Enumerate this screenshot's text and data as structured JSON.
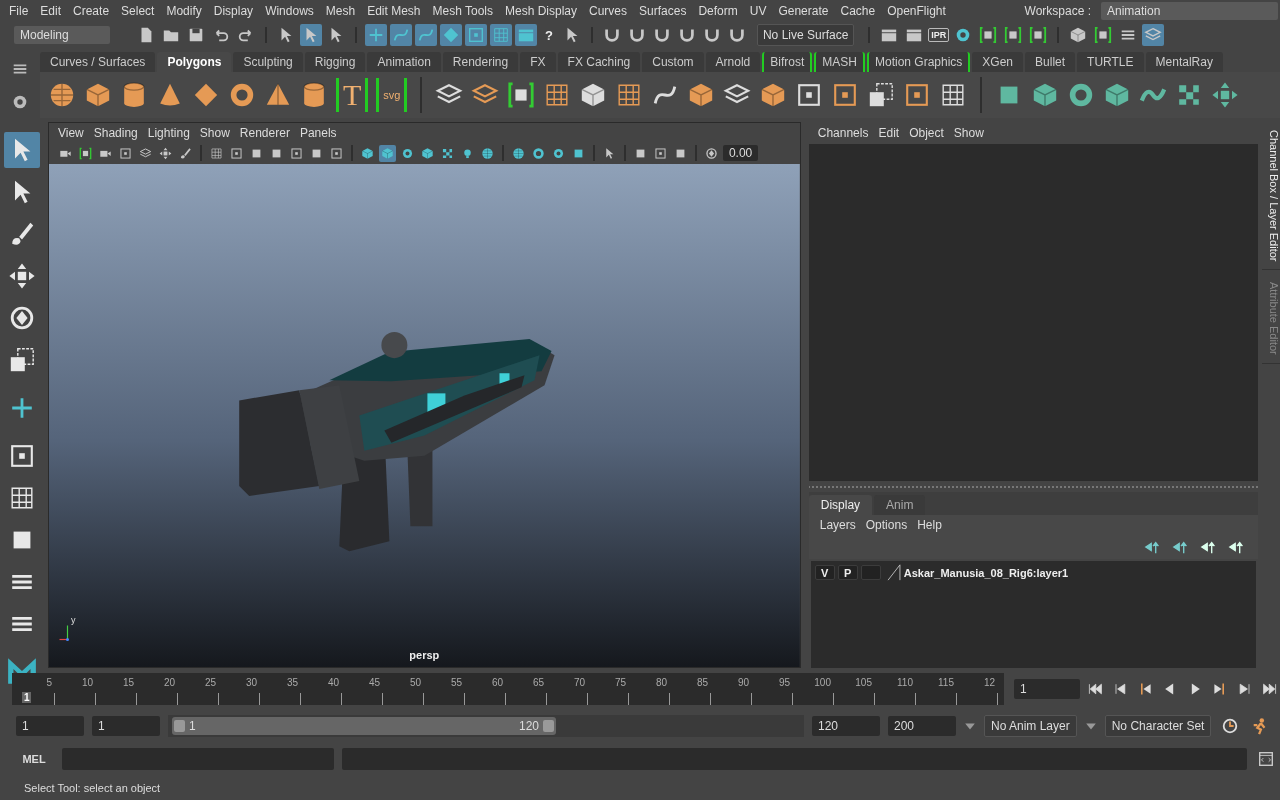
{
  "menu_bar": [
    "File",
    "Edit",
    "Create",
    "Select",
    "Modify",
    "Display",
    "Windows",
    "Mesh",
    "Edit Mesh",
    "Mesh Tools",
    "Mesh Display",
    "Curves",
    "Surfaces",
    "Deform",
    "UV",
    "Generate",
    "Cache",
    "OpenFlight"
  ],
  "status_line": {
    "menu_set": "Modeling",
    "help_glyph": "?",
    "live_surface": "No Live Surface",
    "render_label": "IPR",
    "workspace_label": "Workspace :",
    "workspace": "Animation",
    "tools": [
      {
        "on": false
      },
      {
        "on": false
      },
      {
        "on": false
      },
      {
        "on": false
      },
      {
        "on": false
      },
      {
        "on": false
      },
      {
        "on": true
      },
      {
        "on": false
      },
      {
        "on": true
      },
      {
        "on": true
      },
      {
        "on": true
      },
      {
        "on": true
      },
      {
        "on": true
      },
      {
        "on": true
      },
      {
        "on": true
      },
      {
        "on": false
      },
      {
        "on": false
      },
      {
        "on": false
      },
      {
        "on": false
      },
      {
        "on": false
      },
      {
        "on": false
      },
      {
        "on": false
      },
      {
        "on": false
      },
      {
        "on": false
      },
      {
        "on": false
      },
      {
        "on": false
      },
      {
        "on": false
      },
      {
        "on": false
      },
      {
        "on": false
      },
      {
        "on": false
      },
      {
        "on": false
      },
      {
        "on": false
      },
      {
        "on": false
      },
      {
        "on": true
      }
    ]
  },
  "shelf": {
    "tabs": [
      {
        "label": "Curves / Surfaces",
        "selected": false,
        "bracketed": false
      },
      {
        "label": "Polygons",
        "selected": true,
        "bracketed": false
      },
      {
        "label": "Sculpting",
        "selected": false,
        "bracketed": false
      },
      {
        "label": "Rigging",
        "selected": false,
        "bracketed": false
      },
      {
        "label": "Animation",
        "selected": false,
        "bracketed": false
      },
      {
        "label": "Rendering",
        "selected": false,
        "bracketed": false
      },
      {
        "label": "FX",
        "selected": false,
        "bracketed": false
      },
      {
        "label": "FX Caching",
        "selected": false,
        "bracketed": false
      },
      {
        "label": "Custom",
        "selected": false,
        "bracketed": false
      },
      {
        "label": "Arnold",
        "selected": false,
        "bracketed": false
      },
      {
        "label": "Bifrost",
        "selected": false,
        "bracketed": true
      },
      {
        "label": "MASH",
        "selected": false,
        "bracketed": true
      },
      {
        "label": "Motion Graphics",
        "selected": false,
        "bracketed": true
      },
      {
        "label": "XGen",
        "selected": false,
        "bracketed": false
      },
      {
        "label": "Bullet",
        "selected": false,
        "bracketed": false
      },
      {
        "label": "TURTLE",
        "selected": false,
        "bracketed": false
      },
      {
        "label": "MentalRay",
        "selected": false,
        "bracketed": false
      }
    ],
    "type_tool": "T",
    "svg_tool": "svg"
  },
  "toolbox": [
    {
      "selected": true
    },
    {
      "selected": false
    },
    {
      "selected": false
    },
    {
      "selected": false
    },
    {
      "selected": false
    },
    {
      "selected": false
    },
    {
      "selected": false
    },
    {
      "selected": false
    },
    {
      "selected": false
    },
    {
      "selected": false
    },
    {
      "selected": false
    },
    {
      "selected": false
    }
  ],
  "viewport": {
    "menu": [
      "View",
      "Shading",
      "Lighting",
      "Show",
      "Renderer",
      "Panels"
    ],
    "exposure": "0.00",
    "camera": "persp",
    "axis_label": "y",
    "tools": [
      {
        "on": false
      },
      {
        "on": false
      },
      {
        "on": false
      },
      {
        "on": false
      },
      {
        "on": false
      },
      {
        "on": false
      },
      {
        "on": false
      },
      {
        "on": false
      },
      {
        "on": false
      },
      {
        "on": false
      },
      {
        "on": false
      },
      {
        "on": false
      },
      {
        "on": false
      },
      {
        "on": false
      },
      {
        "on": false
      },
      {
        "on": true
      },
      {
        "on": false
      },
      {
        "on": false
      },
      {
        "on": false
      },
      {
        "on": false
      },
      {
        "on": false
      },
      {
        "on": false
      },
      {
        "on": false
      },
      {
        "on": false
      },
      {
        "on": false
      },
      {
        "on": false
      },
      {
        "on": false
      },
      {
        "on": false
      },
      {
        "on": false
      },
      {
        "on": false
      }
    ]
  },
  "channel_box": {
    "menu": [
      "Channels",
      "Edit",
      "Object",
      "Show"
    ]
  },
  "layer_editor": {
    "tabs": [
      {
        "label": "Display",
        "selected": true
      },
      {
        "label": "Anim",
        "selected": false
      }
    ],
    "menu": [
      "Layers",
      "Options",
      "Help"
    ],
    "layers": [
      {
        "visibility": "V",
        "playback": "P",
        "name": "Askar_Manusia_08_Rig6:layer1"
      }
    ]
  },
  "side_tabs": [
    {
      "label": "Channel Box / Layer Editor",
      "selected": true
    },
    {
      "label": "Attribute Editor",
      "selected": false
    }
  ],
  "timeline": {
    "ticks": [
      "5",
      "10",
      "15",
      "20",
      "25",
      "30",
      "35",
      "40",
      "45",
      "50",
      "55",
      "60",
      "65",
      "70",
      "75",
      "80",
      "85",
      "90",
      "95",
      "100",
      "105",
      "110",
      "115",
      "12"
    ],
    "current_frame": "1",
    "level": 0.01,
    "frame_field": "1"
  },
  "range": {
    "start": "1",
    "playback_start": "1",
    "slider_start": "1",
    "slider_end": "120",
    "playback_end": "120",
    "end": "200",
    "anim_layer": "No Anim Layer",
    "character_set": "No Character Set"
  },
  "command_line": {
    "language": "MEL"
  },
  "help_line": "Select Tool: select an object"
}
